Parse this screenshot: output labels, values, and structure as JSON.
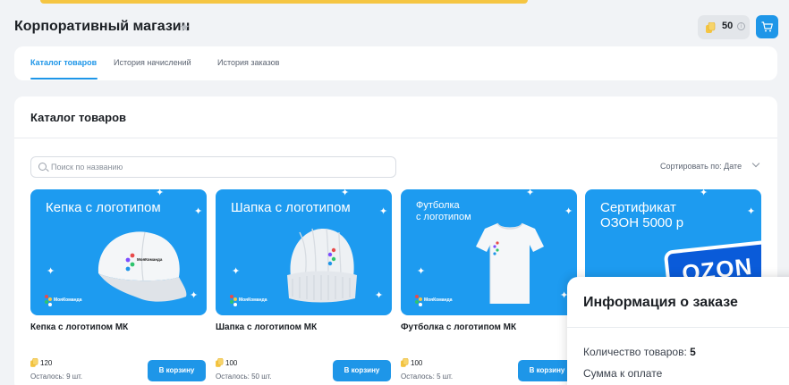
{
  "header": {
    "title": "Корпоративный магазин",
    "balance": "50",
    "info_glyph": "i"
  },
  "tabs": [
    {
      "label": "Каталог товаров",
      "active": true
    },
    {
      "label": "История начислений",
      "active": false
    },
    {
      "label": "История заказов",
      "active": false
    }
  ],
  "catalog": {
    "title": "Каталог товаров",
    "search_placeholder": "Поиск по названию",
    "sort_label": "Сортировать по: Дате",
    "buy_label": "В корзину",
    "products": [
      {
        "banner": "Кепка с логотипом",
        "name": "Кепка с логотипом МК",
        "price": "120",
        "stock": "Осталось: 9 шт."
      },
      {
        "banner": "Шапка с логотипом",
        "name": "Шапка с логотипом МК",
        "price": "100",
        "stock": "Осталось: 50 шт."
      },
      {
        "banner": "Футболка\nс логотипом",
        "name": "Футболка с логотипом МК",
        "price": "100",
        "stock": "Осталось: 5 шт."
      },
      {
        "banner": "Сертификат\nОЗОН 5000 р",
        "name": "",
        "price": "",
        "stock": "",
        "brand_text": "OZON"
      }
    ],
    "logo_text": "МояКоманда"
  },
  "order_panel": {
    "title": "Информация о заказе",
    "items_label": "Количество товаров:",
    "items_count": "5",
    "total_label": "Сумма к оплате"
  },
  "colors": {
    "accent": "#1e96e8",
    "banner": "#1d9bf0",
    "coin": "#f5c542"
  }
}
